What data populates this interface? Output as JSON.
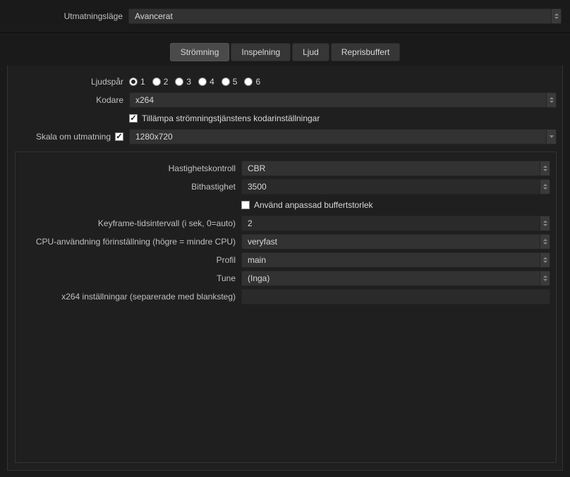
{
  "top": {
    "output_mode_label": "Utmatningsläge",
    "output_mode_value": "Avancerat"
  },
  "tabs": {
    "streaming": "Strömning",
    "recording": "Inspelning",
    "audio": "Ljud",
    "replay": "Reprisbuffert"
  },
  "stream": {
    "audio_track_label": "Ljudspår",
    "tracks": [
      "1",
      "2",
      "3",
      "4",
      "5",
      "6"
    ],
    "encoder_label": "Kodare",
    "encoder_value": "x264",
    "enforce_label": "Tillämpa strömningstjänstens kodarinställningar",
    "rescale_label": "Skala om utmatning",
    "rescale_value": "1280x720"
  },
  "encoder": {
    "rate_control_label": "Hastighetskontroll",
    "rate_control_value": "CBR",
    "bitrate_label": "Bithastighet",
    "bitrate_value": "3500",
    "custom_buffer_label": "Använd anpassad buffertstorlek",
    "keyframe_label": "Keyframe-tidsintervall (i sek, 0=auto)",
    "keyframe_value": "2",
    "cpu_preset_label": "CPU-användning förinställning (högre = mindre CPU)",
    "cpu_preset_value": "veryfast",
    "profile_label": "Profil",
    "profile_value": "main",
    "tune_label": "Tune",
    "tune_value": "(Inga)",
    "x264_opts_label": "x264 inställningar (separerade med blanksteg)",
    "x264_opts_value": ""
  }
}
